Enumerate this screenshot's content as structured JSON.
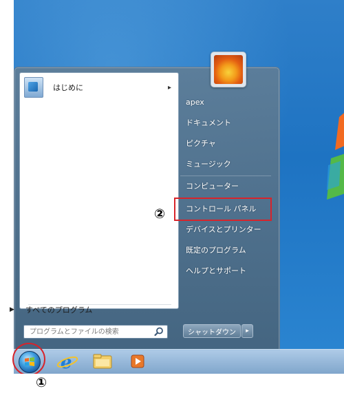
{
  "start_menu": {
    "programs": [
      {
        "label": "はじめに",
        "has_submenu": true,
        "icon": "getting-started-icon"
      }
    ],
    "all_programs_label": "すべてのプログラム",
    "search": {
      "placeholder": "プログラムとファイルの検索"
    },
    "right_column": [
      {
        "label": "apex"
      },
      {
        "label": "ドキュメント"
      },
      {
        "label": "ピクチャ"
      },
      {
        "label": "ミュージック"
      },
      {
        "label": "コンピューター"
      },
      {
        "label": "コントロール パネル"
      },
      {
        "label": "デバイスとプリンター"
      },
      {
        "label": "既定のプログラム"
      },
      {
        "label": "ヘルプとサポート"
      }
    ],
    "shutdown_label": "シャットダウン",
    "shutdown_arrow": "▸",
    "submenu_arrow": "▸",
    "all_programs_arrow": "▶"
  },
  "annotations": {
    "step1": "①",
    "step2": "②",
    "highlight_color": "#d8232a"
  },
  "taskbar": {
    "icons": [
      "start-orb-icon",
      "internet-explorer-icon",
      "explorer-folder-icon",
      "media-player-icon"
    ]
  }
}
